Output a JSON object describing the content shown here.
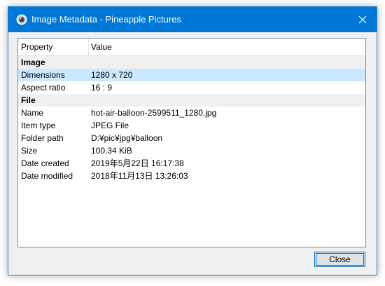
{
  "window": {
    "title": "Image Metadata - Pineapple Pictures",
    "icon": "pineapple-pictures-app-icon",
    "close_icon": "close-icon"
  },
  "columns": {
    "property": "Property",
    "value": "Value"
  },
  "groups": [
    {
      "name": "Image",
      "rows": [
        {
          "key": "Dimensions",
          "value": "1280 x 720",
          "selected": true
        },
        {
          "key": "Aspect ratio",
          "value": "16 : 9",
          "selected": false
        }
      ]
    },
    {
      "name": "File",
      "rows": [
        {
          "key": "Name",
          "value": "hot-air-balloon-2599511_1280.jpg",
          "selected": false
        },
        {
          "key": "Item type",
          "value": "JPEG File",
          "selected": false
        },
        {
          "key": "Folder path",
          "value": "D:¥pic¥jpg¥balloon",
          "selected": false
        },
        {
          "key": "Size",
          "value": "100.34 KiB",
          "selected": false
        },
        {
          "key": "Date created",
          "value": "2019年5月22日 16:17:38",
          "selected": false
        },
        {
          "key": "Date modified",
          "value": "2018年11月13日 13:26:03",
          "selected": false
        }
      ]
    }
  ],
  "buttons": {
    "close": "Close"
  },
  "colors": {
    "titlebar": "#0078d7",
    "selection": "#cce8ff",
    "group_background": "#f0f0f0"
  }
}
